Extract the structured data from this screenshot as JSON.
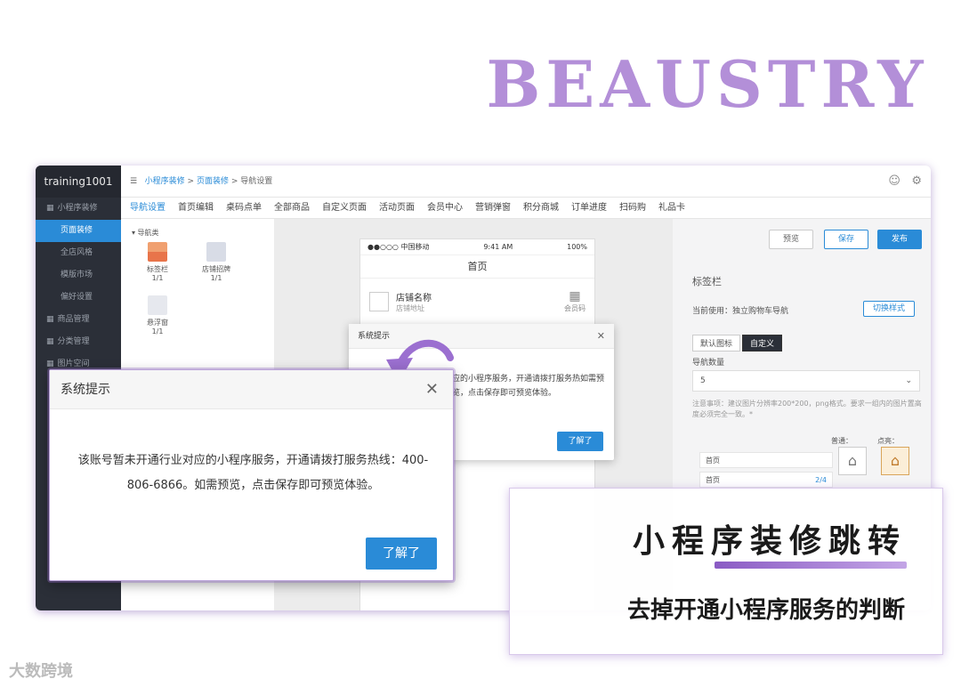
{
  "brand": "BEAUSTRY",
  "app": {
    "account": "training1001",
    "sidebar": [
      {
        "label": "小程序装修",
        "group": true
      },
      {
        "label": "页面装修",
        "active": true
      },
      {
        "label": "全店风格"
      },
      {
        "label": "模版市场"
      },
      {
        "label": "偏好设置"
      },
      {
        "label": "商品管理",
        "group": true
      },
      {
        "label": "分类管理",
        "group": true
      },
      {
        "label": "图片空间",
        "group": true
      }
    ],
    "breadcrumb": [
      "小程序装修",
      "页面装修",
      "导航设置"
    ],
    "tabs": [
      "导航设置",
      "首页编辑",
      "桌码点单",
      "全部商品",
      "自定义页面",
      "活动页面",
      "会员中心",
      "营销弹窗",
      "积分商城",
      "订单进度",
      "扫码购",
      "礼品卡"
    ],
    "widgets_title": "▾ 导航类",
    "widgets": [
      {
        "label": "标签栏",
        "count": "1/1"
      },
      {
        "label": "店铺招牌",
        "count": "1/1"
      },
      {
        "label": "悬浮窗",
        "count": "1/1"
      }
    ],
    "phone": {
      "carrier": "●●○○○ 中国移动",
      "time": "9:41 AM",
      "battery": "100%",
      "title": "首页",
      "store_name": "店铺名称",
      "store_addr": "店铺地址",
      "qr_label": "会员码"
    },
    "right": {
      "preview": "预览",
      "save": "保存",
      "publish": "发布",
      "section": "标签栏",
      "current": "当前使用：独立购物车导航",
      "switch_style": "切换样式",
      "tab_default": "默认图标",
      "tab_custom": "自定义",
      "nav_count_label": "导航数量",
      "nav_count": "5",
      "note": "注意事项：建议图片分辨率200*200，png格式。要求一组内的图片置高度必须完全一致。*",
      "normal": "普通：",
      "active": "点亮：",
      "row1": "首页",
      "row2": "首页",
      "row2_count": "2/4"
    }
  },
  "dialog_small": {
    "title": "系统提示",
    "body": "应的小程序服务，开通请拨打服务热如需预览，点击保存即可预览体验。",
    "ok": "了解了"
  },
  "dialog_large": {
    "title": "系统提示",
    "body": "该账号暂未开通行业对应的小程序服务，开通请拨打服务热线：400-806-6866。如需预览，点击保存即可预览体验。",
    "ok": "了解了"
  },
  "overlay": {
    "headline": "小程序装修跳转",
    "subline": "去掉开通小程序服务的判断"
  },
  "watermark": "大数跨境",
  "colors": {
    "accent": "#2a8bd7",
    "brand": "#b38fd8",
    "purple": "#8a5bc4"
  }
}
